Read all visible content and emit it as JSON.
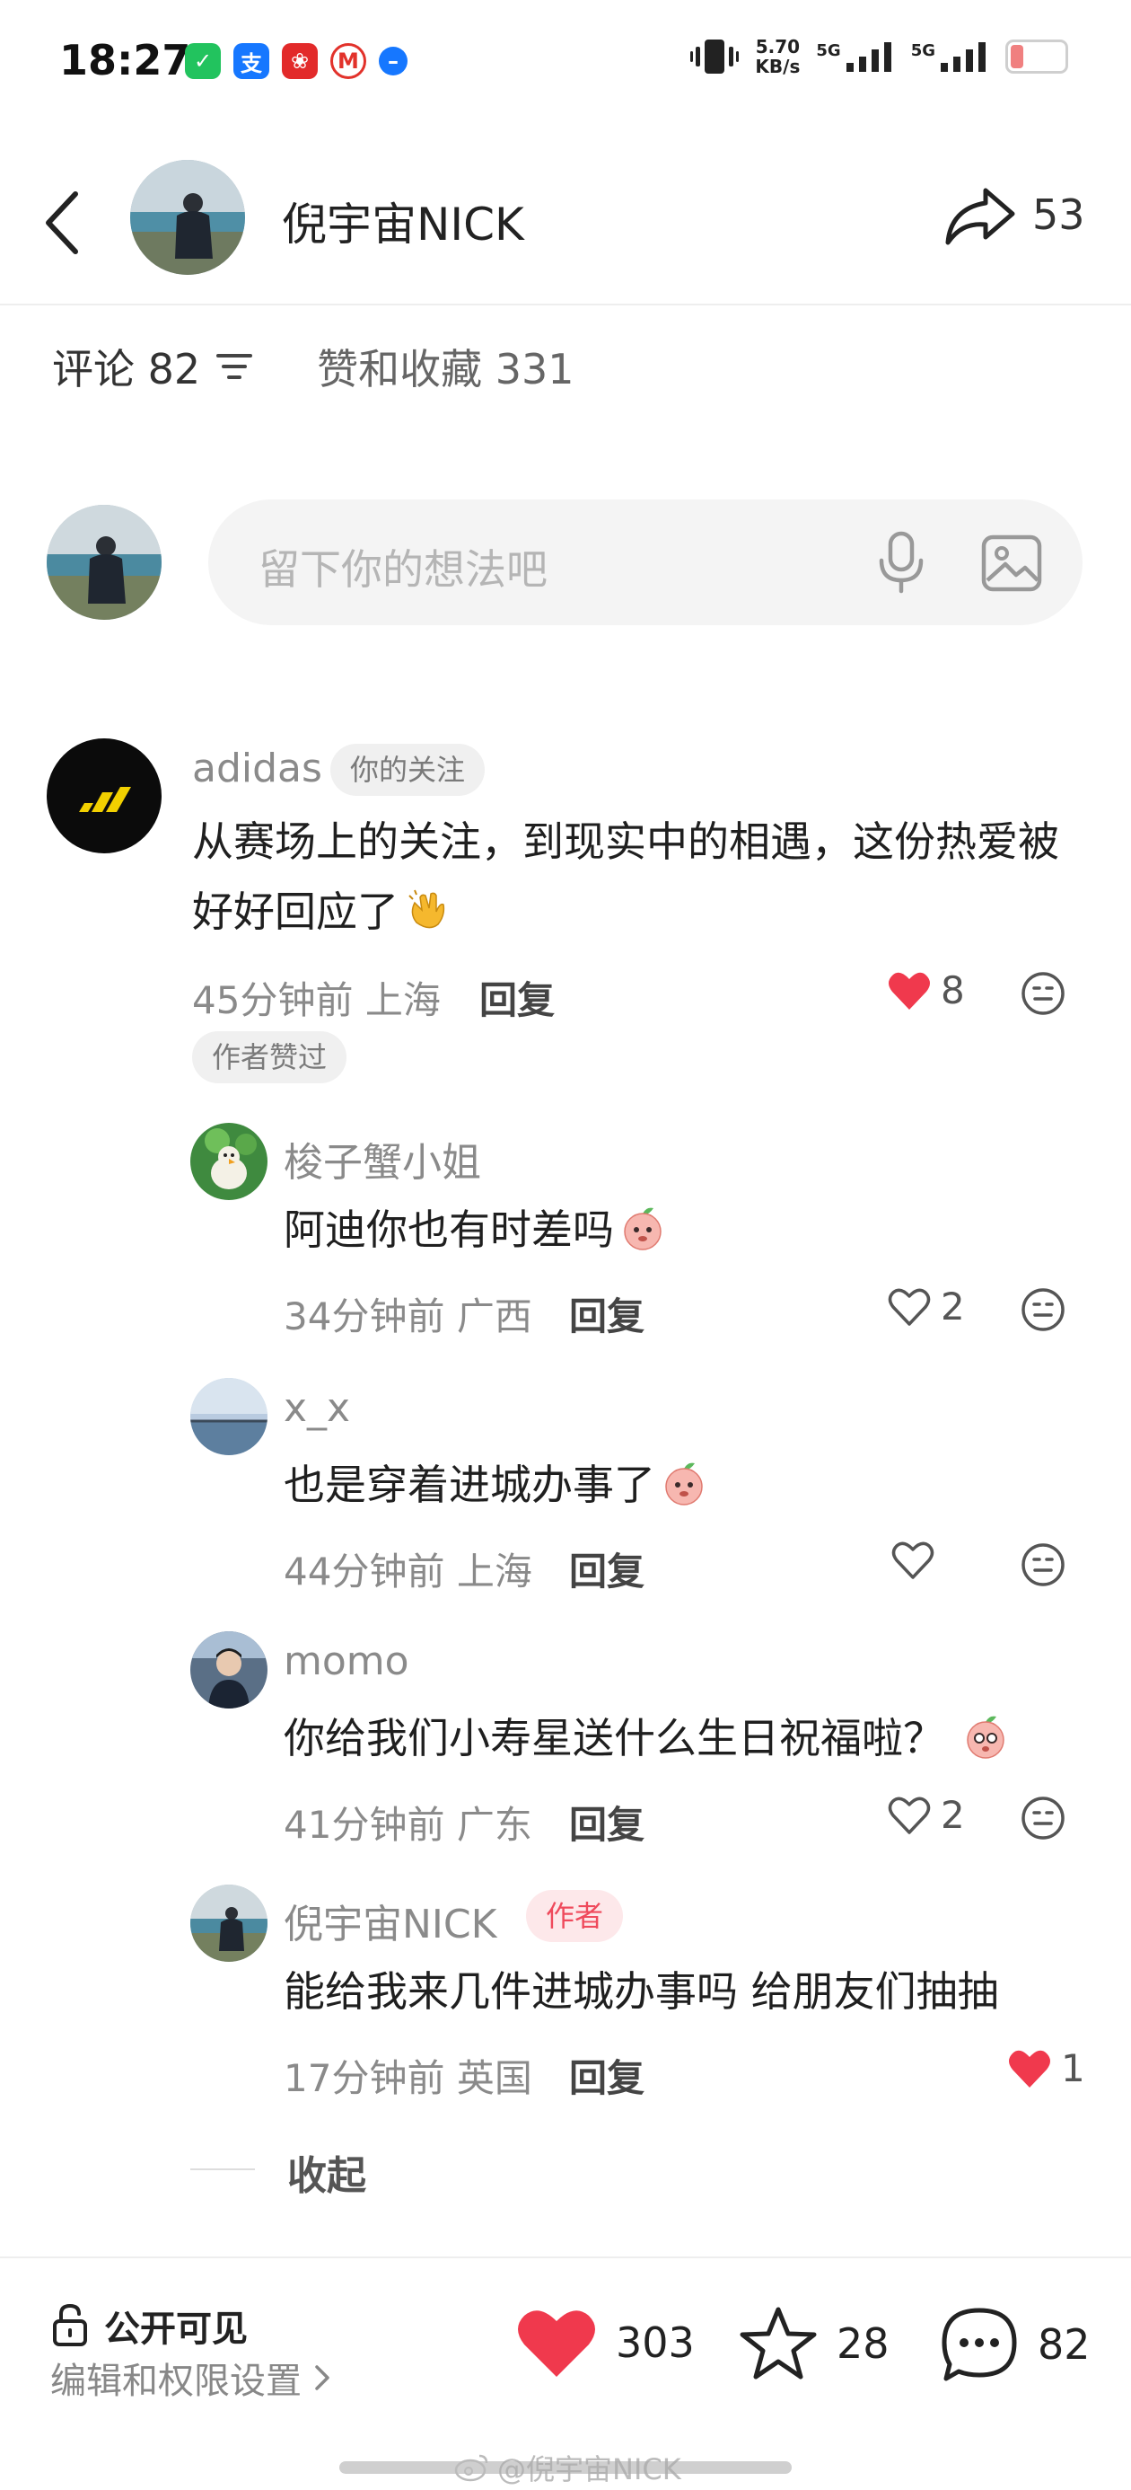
{
  "status_bar": {
    "time": "18:27",
    "speed_value": "5.70",
    "speed_unit": "KB/s",
    "net1": "5G",
    "net2": "5G",
    "app_glyphs": [
      "✓",
      "支",
      "❀",
      "M",
      "–"
    ]
  },
  "header": {
    "name": "倪宇宙NICK",
    "share_count": "53"
  },
  "tabs": {
    "comments": "评论 82",
    "likes": "赞和收藏 331"
  },
  "input": {
    "placeholder": "留下你的想法吧"
  },
  "comments": [
    {
      "user": "adidas",
      "badge": "你的关注",
      "text": "从赛场上的关注，到现实中的相遇，这份热爱被好好回应了",
      "emoji": "clapping-hands",
      "time": "45分钟前",
      "location": "上海",
      "reply": "回复",
      "likes": "8",
      "liked": true,
      "author_liked": "作者赞过"
    },
    {
      "user": "梭子蟹小姐",
      "text": "阿迪你也有时差吗",
      "emoji": "peach-face",
      "time": "34分钟前",
      "location": "广西",
      "reply": "回复",
      "likes": "2",
      "liked": false
    },
    {
      "user": "x_x",
      "text": "也是穿着进城办事了",
      "emoji": "peach-face",
      "time": "44分钟前",
      "location": "上海",
      "reply": "回复",
      "likes": "",
      "liked": false
    },
    {
      "user": "momo",
      "text": "你给我们小寿星送什么生日祝福啦？",
      "emoji": "peach-face",
      "time": "41分钟前",
      "location": "广东",
      "reply": "回复",
      "likes": "2",
      "liked": false
    },
    {
      "user": "倪宇宙NICK",
      "badge": "作者",
      "text": "能给我来几件进城办事吗 给朋友们抽抽",
      "time": "17分钟前",
      "location": "英国",
      "reply": "回复",
      "likes": "1",
      "liked": true
    }
  ],
  "collapse": "收起",
  "bottom": {
    "visibility_title": "公开可见",
    "visibility_sub": "编辑和权限设置",
    "likes": "303",
    "favorites": "28",
    "comments": "82"
  },
  "watermark": "@倪宇宙NICK",
  "colors": {
    "like_red": "#f0394d",
    "author_pink": "#ef4a5c",
    "muted_text": "#8a8a8a"
  }
}
